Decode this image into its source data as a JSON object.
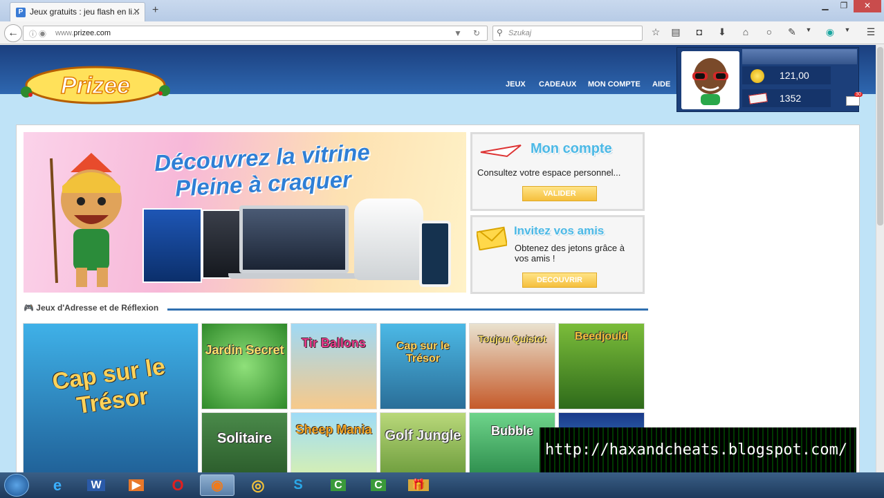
{
  "browser": {
    "tab_title": "Jeux gratuits : jeu flash en li...",
    "url_prefix": "www.",
    "url_domain": "prizee.com",
    "search_placeholder": "Szukaj"
  },
  "site": {
    "logo_text": "Prizee",
    "nav": [
      "JEUX",
      "CADEAUX",
      "MON COMPTE",
      "AIDE"
    ],
    "user": {
      "coins": "121,00",
      "tickets": "1352",
      "mail_count": "30"
    }
  },
  "banner": {
    "line1": "Découvrez la vitrine",
    "line2": "Pleine à craquer"
  },
  "cards": {
    "account": {
      "title": "Mon compte",
      "text": "Consultez votre espace personnel...",
      "button": "VALIDER"
    },
    "invite": {
      "title": "Invitez vos amis",
      "text": "Obtenez des jetons grâce à vos amis !",
      "button": "DECOUVRIR"
    }
  },
  "section": {
    "title": "Jeux d'Adresse et de Réflexion"
  },
  "games": [
    {
      "title": "Cap sur le Trésor"
    },
    {
      "title": "Jardin Secret"
    },
    {
      "title": "Tir Ballons"
    },
    {
      "title": "Cap sur le Trésor"
    },
    {
      "title": "Toujou Quistot"
    },
    {
      "title": "Beedjould"
    },
    {
      "title": "Solitaire"
    },
    {
      "title": "Sheep Mania"
    },
    {
      "title": "Golf Jungle"
    },
    {
      "title": "Bubble"
    },
    {
      "title": ""
    }
  ],
  "watermark": "http://haxandcheats.blogspot.com/",
  "colors": {
    "header": "#1b3f7e",
    "page_bg": "#bfe3f7",
    "card_title": "#4cb9e6",
    "button": "#f5bf3d"
  },
  "taskbar_apps": [
    "start-orb",
    "internet-explorer-icon",
    "word-icon",
    "media-player-icon",
    "opera-icon",
    "firefox-icon",
    "chrome-icon",
    "skype-icon",
    "camtasia-icon",
    "camtasia-icon",
    "prizee-icon"
  ]
}
